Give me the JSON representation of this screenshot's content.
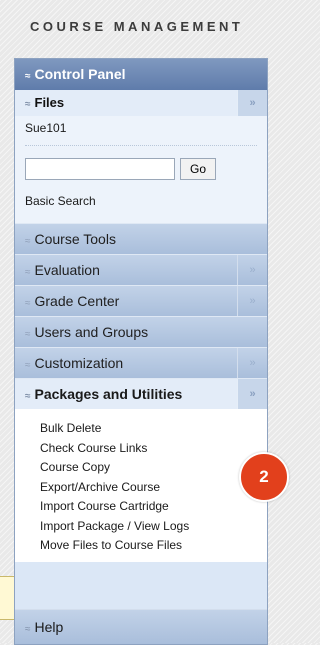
{
  "heading": "COURSE MANAGEMENT",
  "control_panel": {
    "title": "Control Panel"
  },
  "files": {
    "title": "Files",
    "items": [
      "Sue101"
    ],
    "search": {
      "value": "",
      "go_label": "Go",
      "basic_search": "Basic Search"
    }
  },
  "collapsed_sections": [
    {
      "label": "Course Tools",
      "expander": false
    },
    {
      "label": "Evaluation",
      "expander": true
    },
    {
      "label": "Grade Center",
      "expander": true
    },
    {
      "label": "Users and Groups",
      "expander": false
    },
    {
      "label": "Customization",
      "expander": true
    }
  ],
  "packages": {
    "title": "Packages and Utilities",
    "items": [
      "Bulk Delete",
      "Check Course Links",
      "Course Copy",
      "Export/Archive Course",
      "Import Course Cartridge",
      "Import Package / View Logs",
      "Move Files to Course Files"
    ]
  },
  "help": {
    "label": "Help"
  },
  "marker": {
    "number": "2"
  },
  "icons": {
    "expanded": "chevron-up-icon",
    "collapsed": "chevron-down-icon",
    "expander": "double-chevron-right-icon"
  },
  "colors": {
    "panel_header": "#6b86b3",
    "marker": "#e2401c"
  }
}
